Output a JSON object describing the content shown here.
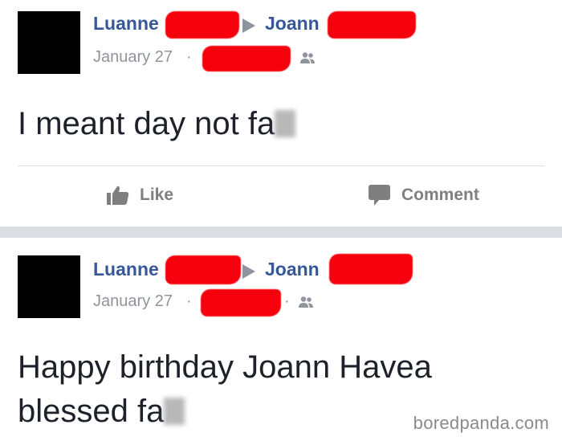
{
  "posts": [
    {
      "author": "Luanne",
      "recipient": "Joann",
      "date": "January 27",
      "separator": "·",
      "text_line1": "I meant day not fa",
      "actions": {
        "like": "Like",
        "comment": "Comment"
      }
    },
    {
      "author": "Luanne",
      "recipient": "Joann",
      "date": "January 27",
      "separator": "·",
      "text_line1": "Happy birthday Joann Havea",
      "text_line2": "blessed fa"
    }
  ],
  "watermark": "boredpanda.com",
  "colors": {
    "name": "#365899",
    "meta": "#90949c",
    "redaction": "#f5000c",
    "separator": "#dcdee3"
  },
  "icons": [
    "like-thumb-icon",
    "comment-bubble-icon",
    "friends-audience-icon",
    "arrow-right-icon"
  ]
}
